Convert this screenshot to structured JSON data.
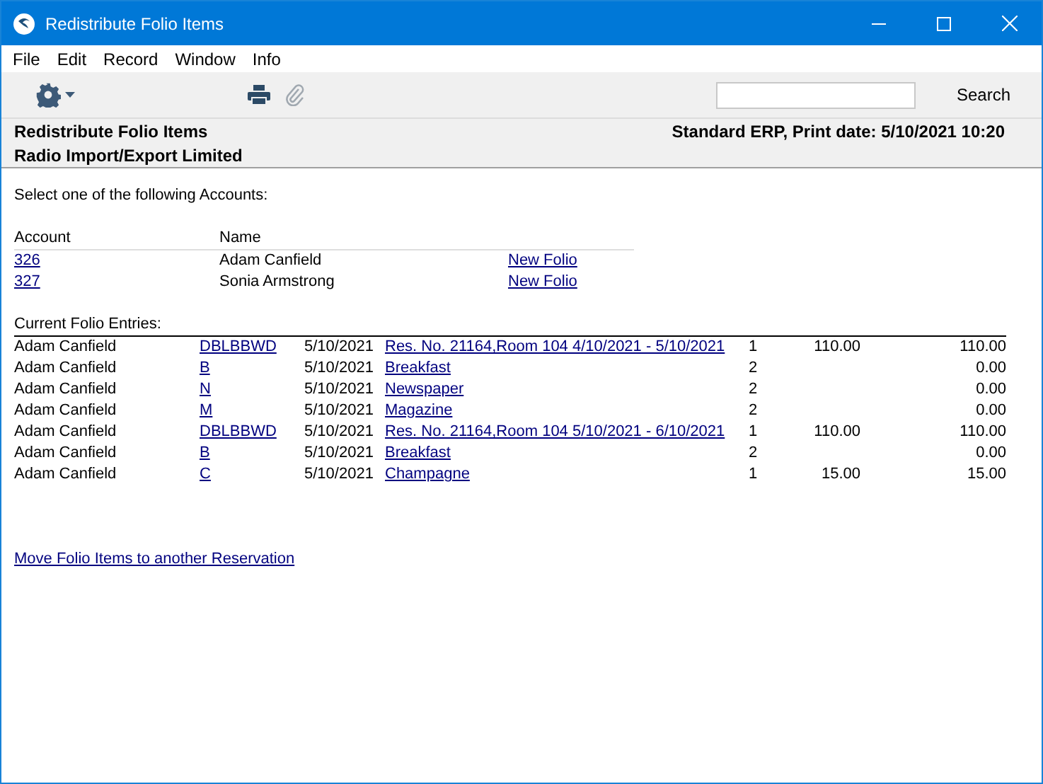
{
  "window": {
    "title": "Redistribute Folio Items"
  },
  "menu": [
    "File",
    "Edit",
    "Record",
    "Window",
    "Info"
  ],
  "toolbar": {
    "search_button": "Search"
  },
  "header": {
    "title": "Redistribute Folio Items",
    "company": "Radio Import/Export Limited",
    "print_info": "Standard ERP, Print date: 5/10/2021 10:20"
  },
  "prompt": "Select one of the following Accounts:",
  "accounts": {
    "columns": [
      "Account",
      "Name"
    ],
    "rows": [
      {
        "account": "326",
        "name": "Adam Canfield",
        "action": "New Folio"
      },
      {
        "account": "327",
        "name": "Sonia Armstrong",
        "action": "New Folio"
      }
    ]
  },
  "entries": {
    "title": "Current Folio Entries:",
    "rows": [
      {
        "name": "Adam Canfield",
        "code": "DBLBBWD",
        "date": "5/10/2021",
        "description": "Res. No. 21164,Room 104 4/10/2021 - 5/10/2021",
        "qty": "1",
        "price": "110.00",
        "total": "110.00"
      },
      {
        "name": "Adam Canfield",
        "code": "B",
        "date": "5/10/2021",
        "description": "Breakfast",
        "qty": "2",
        "price": "",
        "total": "0.00"
      },
      {
        "name": "Adam Canfield",
        "code": "N",
        "date": "5/10/2021",
        "description": "Newspaper",
        "qty": "2",
        "price": "",
        "total": "0.00"
      },
      {
        "name": "Adam Canfield",
        "code": "M",
        "date": "5/10/2021",
        "description": "Magazine",
        "qty": "2",
        "price": "",
        "total": "0.00"
      },
      {
        "name": "Adam Canfield",
        "code": "DBLBBWD",
        "date": "5/10/2021",
        "description": "Res. No. 21164,Room 104 5/10/2021 - 6/10/2021",
        "qty": "1",
        "price": "110.00",
        "total": "110.00"
      },
      {
        "name": "Adam Canfield",
        "code": "B",
        "date": "5/10/2021",
        "description": "Breakfast",
        "qty": "2",
        "price": "",
        "total": "0.00"
      },
      {
        "name": "Adam Canfield",
        "code": "C",
        "date": "5/10/2021",
        "description": "Champagne",
        "qty": "1",
        "price": "15.00",
        "total": "15.00"
      }
    ]
  },
  "footer_link": "Move Folio Items to another Reservation"
}
